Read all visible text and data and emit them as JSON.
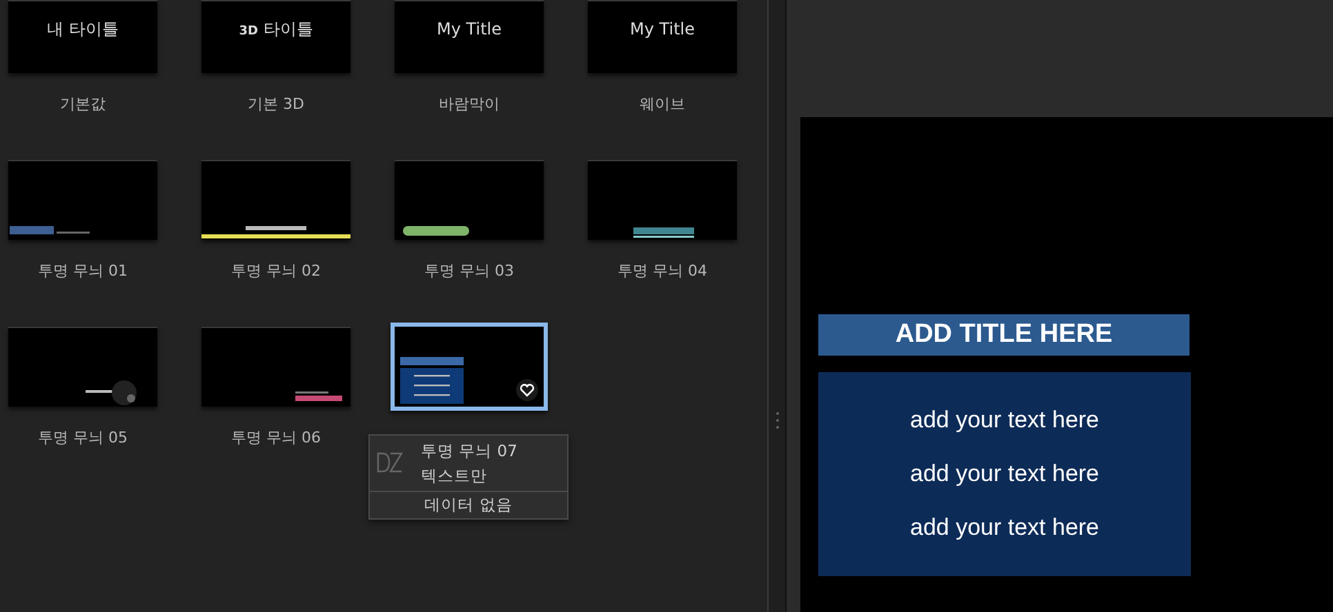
{
  "tiles": [
    {
      "kind": "plain-title",
      "thumb_text": "내 타이틀",
      "label": "기본값",
      "selected": false
    },
    {
      "kind": "badge-title",
      "thumb_badge": "3D",
      "thumb_text": "타이틀",
      "label": "기본 3D",
      "selected": false
    },
    {
      "kind": "plain-title",
      "thumb_text": "My Title",
      "label": "바람막이",
      "selected": false
    },
    {
      "kind": "plain-title",
      "thumb_text": "My Title",
      "label": "웨이브",
      "selected": false
    },
    {
      "kind": "left-bar",
      "label": "투명 무늬 01",
      "selected": false
    },
    {
      "kind": "underline",
      "label": "투명 무늬 02",
      "selected": false
    },
    {
      "kind": "pill",
      "label": "투명 무늬 03",
      "selected": false
    },
    {
      "kind": "teal-bar",
      "label": "투명 무늬 04",
      "selected": false
    },
    {
      "kind": "circle",
      "label": "투명 무늬 05",
      "selected": false
    },
    {
      "kind": "pink-bar",
      "label": "투명 무늬 06",
      "selected": false
    },
    {
      "kind": "box",
      "selected": true,
      "favorite": true
    }
  ],
  "tooltip": {
    "name": "투명 무늬 07",
    "type": "텍스트만",
    "data": "데이터 없음"
  },
  "preview": {
    "title": "ADD TITLE HERE",
    "lines": [
      "add your text here",
      "add your text here",
      "add your text here"
    ]
  }
}
